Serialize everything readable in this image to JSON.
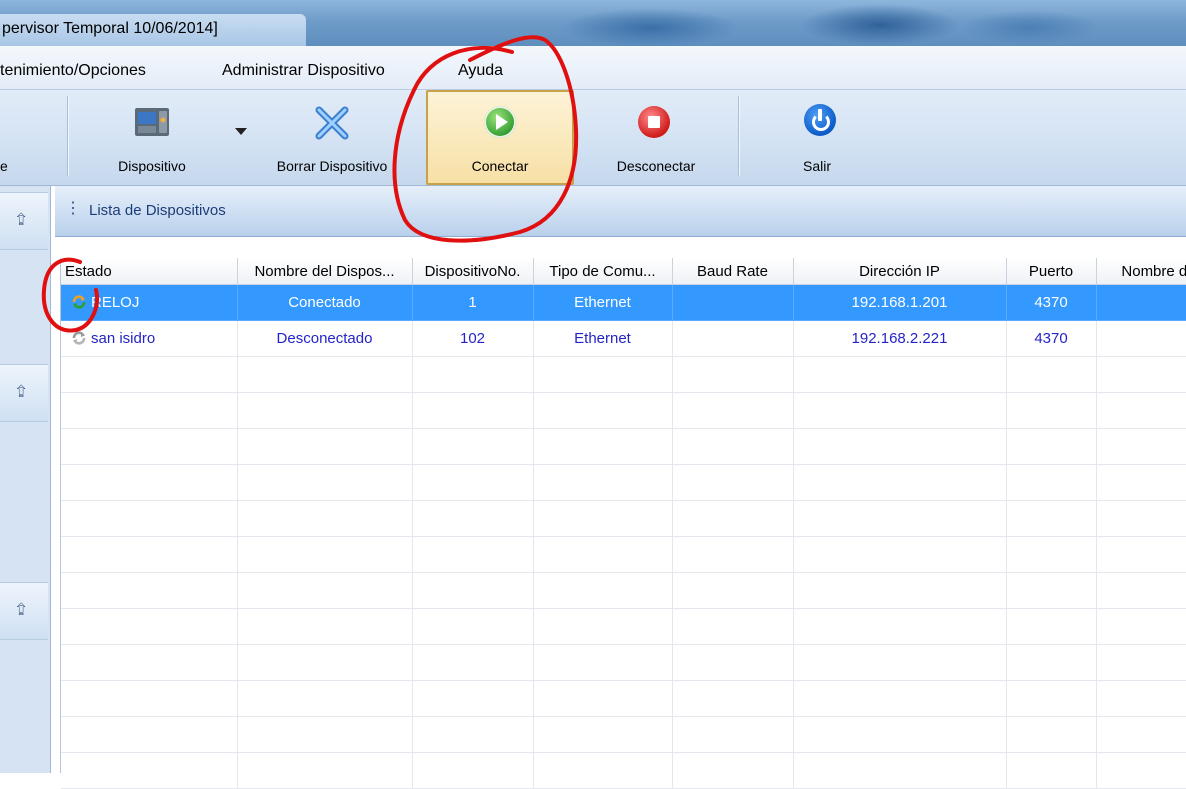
{
  "window": {
    "title": "pervisor Temporal 10/06/2014]"
  },
  "menu": {
    "items": [
      "tenimiento/Opciones",
      "Administrar Dispositivo",
      "Ayuda"
    ]
  },
  "toolbar": {
    "partial_label": "e",
    "buttons": [
      {
        "label": "Dispositivo",
        "icon": "device-terminal-icon"
      },
      {
        "label": "Borrar Dispositivo",
        "icon": "delete-x-icon"
      },
      {
        "label": "Conectar",
        "icon": "play-icon",
        "active": true
      },
      {
        "label": "Desconectar",
        "icon": "stop-icon"
      },
      {
        "label": "Salir",
        "icon": "power-icon"
      }
    ]
  },
  "panel": {
    "title": "Lista de Dispositivos"
  },
  "table": {
    "columns": [
      "Estado",
      "Nombre del Dispos...",
      "DispositivoNo.",
      "Tipo de Comu...",
      "Baud Rate",
      "Dirección IP",
      "Puerto",
      "Nombre de"
    ],
    "rows": [
      {
        "name": "RELOJ",
        "status": "Conectado",
        "number": "1",
        "comm": "Ethernet",
        "baud": "",
        "ip": "192.168.1.201",
        "port": "4370",
        "extra": "",
        "selected": true,
        "status_icon": "sync-active-icon"
      },
      {
        "name": "san isidro",
        "status": "Desconectado",
        "number": "102",
        "comm": "Ethernet",
        "baud": "",
        "ip": "192.168.2.221",
        "port": "4370",
        "extra": "",
        "selected": false,
        "status_icon": "sync-inactive-icon"
      }
    ]
  },
  "colors": {
    "selection": "#3399ff",
    "link_text": "#2424c8",
    "annotation": "#e01010"
  }
}
